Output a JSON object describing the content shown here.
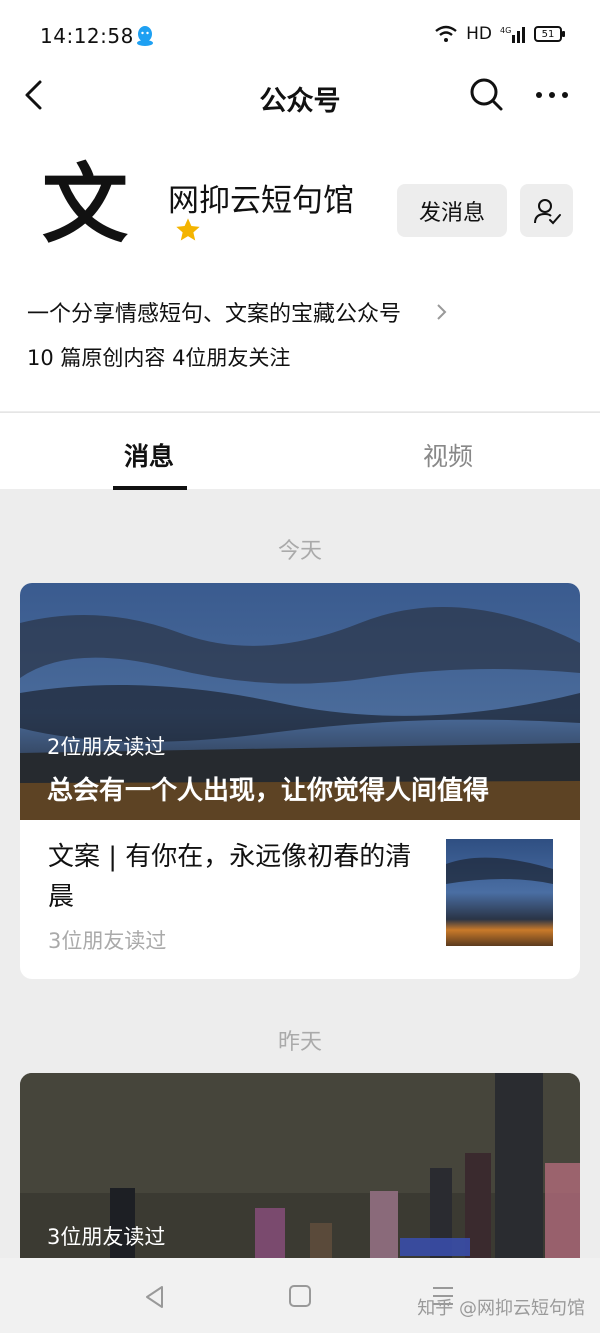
{
  "status_bar": {
    "time": "14:12:58",
    "network": "HD",
    "signal": "4G",
    "battery": "51"
  },
  "nav": {
    "title": "公众号"
  },
  "account": {
    "avatar_glyph": "文",
    "name": "网抑云短句馆",
    "send_message_label": "发消息",
    "description": "一个分享情感短句、文案的宝藏公众号",
    "stats": "10 篇原创内容  4位朋友关注"
  },
  "tabs": [
    {
      "label": "消息",
      "active": true
    },
    {
      "label": "视频",
      "active": false
    }
  ],
  "feed": {
    "today_label": "今天",
    "yesterday_label": "昨天",
    "card1": {
      "cover_reads": "2位朋友读过",
      "cover_title": "总会有一个人出现，让你觉得人间值得",
      "sub_title": "文案 | 有你在，永远像初春的清晨",
      "sub_reads": "3位朋友读过"
    },
    "card2": {
      "cover_reads": "3位朋友读过"
    }
  },
  "watermark": "知乎 @网抑云短句馆",
  "colors": {
    "accent_star": "#f4b400",
    "background": "#ededed",
    "text": "#111111",
    "muted": "#aaaaaa"
  },
  "icons": {
    "back": "chevron-left-icon",
    "search": "search-icon",
    "more": "more-icon",
    "follow": "user-check-icon",
    "star": "star-icon"
  }
}
